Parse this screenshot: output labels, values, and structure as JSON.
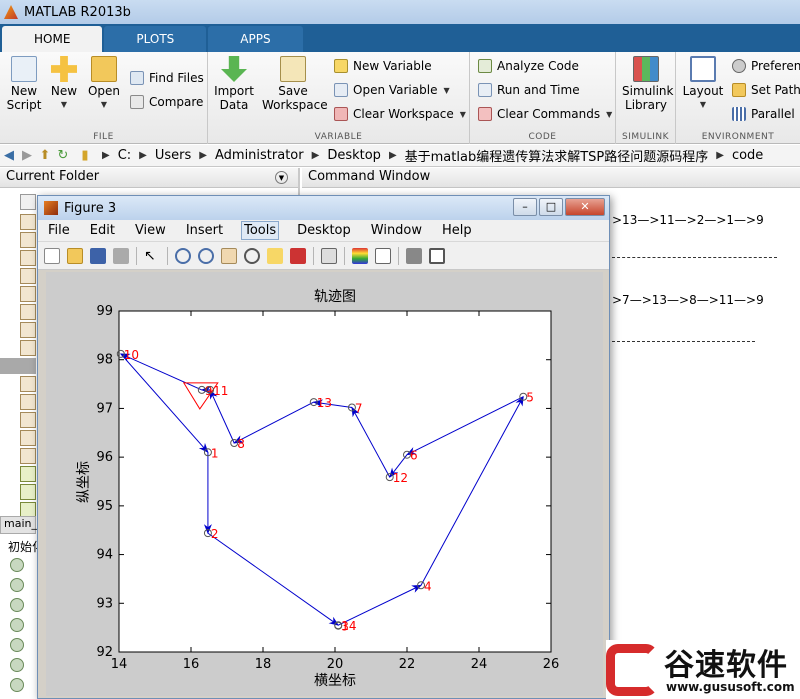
{
  "window": {
    "title": "MATLAB R2013b"
  },
  "tabs": [
    {
      "label": "HOME",
      "active": true
    },
    {
      "label": "PLOTS",
      "active": false
    },
    {
      "label": "APPS",
      "active": false
    }
  ],
  "ribbon": {
    "file": {
      "label": "FILE",
      "new_script": "New\nScript",
      "new": "New",
      "open": "Open",
      "find_files": "Find Files",
      "compare": "Compare"
    },
    "variable": {
      "label": "VARIABLE",
      "import_data": "Import\nData",
      "save_workspace": "Save\nWorkspace",
      "new_variable": "New Variable",
      "open_variable": "Open Variable",
      "clear_workspace": "Clear Workspace"
    },
    "code": {
      "label": "CODE",
      "analyze_code": "Analyze Code",
      "run_and_time": "Run and Time",
      "clear_commands": "Clear Commands"
    },
    "simulink": {
      "label": "SIMULINK",
      "library": "Simulink\nLibrary"
    },
    "environment": {
      "label": "ENVIRONMENT",
      "layout": "Layout",
      "preferences": "Preferen",
      "set_path": "Set Path",
      "parallel": "Parallel"
    }
  },
  "address": {
    "crumbs": [
      "C:",
      "Users",
      "Administrator",
      "Desktop",
      "基于matlab编程遗传算法求解TSP路径问题源码程序",
      "code"
    ]
  },
  "current_folder": {
    "title": "Current Folder",
    "tab_label": "main_",
    "detail_label": "初始化"
  },
  "command_window": {
    "title": "Command Window",
    "line1": ">13—>11—>2—>1—>9",
    "line2": ">7—>13—>8—>11—>9"
  },
  "figure": {
    "title": "Figure 3",
    "menu": [
      "File",
      "Edit",
      "View",
      "Insert",
      "Tools",
      "Desktop",
      "Window",
      "Help"
    ],
    "highlighted_menu": "Tools"
  },
  "chart_data": {
    "type": "line",
    "title": "轨迹图",
    "xlabel": "横坐标",
    "ylabel": "纵坐标",
    "xlim": [
      14,
      26
    ],
    "ylim": [
      92,
      99
    ],
    "xticks": [
      14,
      16,
      18,
      20,
      22,
      24,
      26
    ],
    "yticks": [
      92,
      93,
      94,
      95,
      96,
      97,
      98,
      99
    ],
    "points": [
      {
        "id": "1",
        "x": 16.47,
        "y": 96.1
      },
      {
        "id": "2",
        "x": 16.47,
        "y": 94.44
      },
      {
        "id": "3",
        "x": 20.09,
        "y": 92.54
      },
      {
        "id": "4",
        "x": 22.39,
        "y": 93.37
      },
      {
        "id": "5",
        "x": 25.23,
        "y": 97.24
      },
      {
        "id": "6",
        "x": 22.0,
        "y": 96.05
      },
      {
        "id": "7",
        "x": 20.47,
        "y": 97.02
      },
      {
        "id": "8",
        "x": 17.2,
        "y": 96.29
      },
      {
        "id": "9",
        "x": 16.3,
        "y": 97.38
      },
      {
        "id": "10",
        "x": 14.05,
        "y": 98.12
      },
      {
        "id": "11",
        "x": 16.53,
        "y": 97.38
      },
      {
        "id": "12",
        "x": 21.52,
        "y": 95.59
      },
      {
        "id": "13",
        "x": 19.41,
        "y": 97.13
      },
      {
        "id": "14",
        "x": 20.09,
        "y": 92.55
      }
    ],
    "route": [
      "1",
      "2",
      "14",
      "4",
      "5",
      "6",
      "12",
      "7",
      "13",
      "8",
      "11",
      "9",
      "10",
      "1"
    ],
    "start_marker": {
      "shape": "triangle",
      "color": "#ff0000",
      "at": "9"
    },
    "line_color": "#0000cc",
    "label_color": "#ff0000",
    "grid": false
  },
  "watermark": {
    "name": "谷速软件",
    "url": "www.gususoft.com"
  }
}
